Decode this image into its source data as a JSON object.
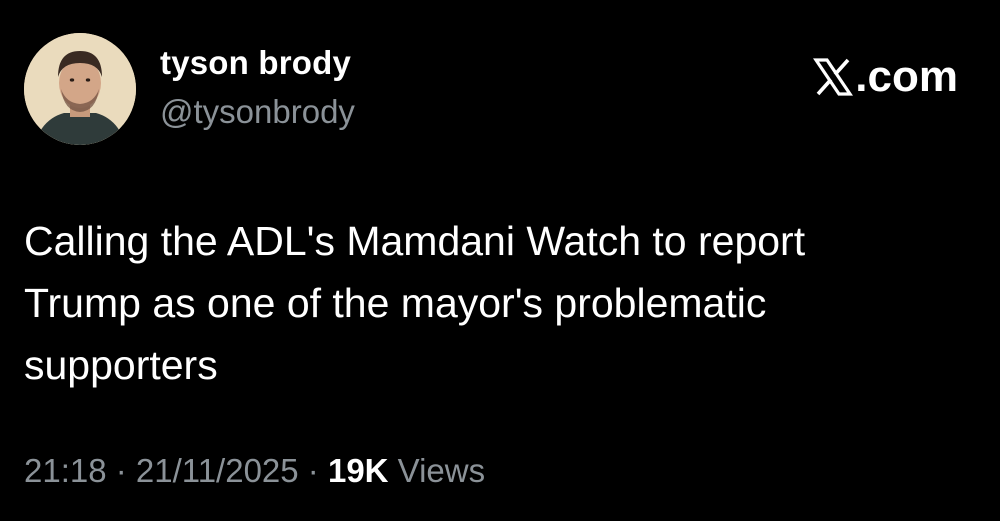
{
  "author": {
    "display_name": "tyson brody",
    "handle": "@tysonbrody"
  },
  "brand": {
    "label": ".com",
    "icon": "x-logo-icon"
  },
  "tweet": {
    "text": "Calling the ADL's Mamdani Watch to report\nTrump as one of the mayor's problematic\nsupporters"
  },
  "meta": {
    "time": "21:18",
    "separator": " · ",
    "date": "21/11/2025",
    "views_count": "19K",
    "views_label": " Views"
  },
  "colors": {
    "background": "#000000",
    "text": "#ffffff",
    "secondary_text": "#8b9298"
  }
}
